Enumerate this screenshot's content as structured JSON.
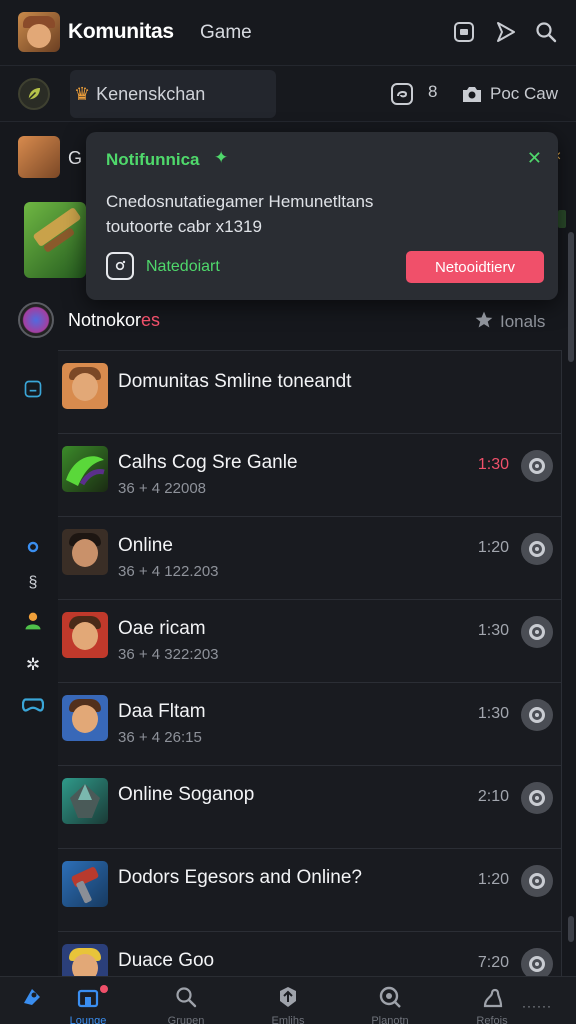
{
  "header": {
    "title": "Komunitas",
    "subtitle": "Game",
    "icons": [
      "window-icon",
      "send-icon",
      "search-icon"
    ]
  },
  "subbar": {
    "pill_label": "Kenenskchan",
    "right_label": "Poc Caw",
    "count": "8"
  },
  "row0": {
    "label": "G"
  },
  "notification": {
    "title": "Notifunnica",
    "body_line1": "Cnedosnutatiegamer Hemunetltans",
    "body_line2": "toutoorte cabr x1319",
    "link": "Natedoiart",
    "button": "Netooidtierv"
  },
  "section": {
    "title_main": "Notnokor",
    "title_accent": "es",
    "right_label": "Ionals"
  },
  "items": [
    {
      "name": "Domunitas Smline toneandt",
      "meta": "",
      "time": "",
      "highlight": false,
      "thumb": "#d88b4e",
      "hair": "#7b4826"
    },
    {
      "name": "Calhs Cog Sre Ganle",
      "meta": "36 + 4 22008",
      "time": "1:30",
      "highlight": true,
      "thumb": "#3b8a2a",
      "hair": "#5a2f8a"
    },
    {
      "name": "Online",
      "meta": "36 + 4 122.203",
      "time": "1:20",
      "highlight": false,
      "thumb": "#3a2e26",
      "hair": "#1d1612"
    },
    {
      "name": "Oae ricam",
      "meta": "36 + 4 322:203",
      "time": "1:30",
      "highlight": false,
      "thumb": "#c0392b",
      "hair": "#4a2a18"
    },
    {
      "name": "Daa Fltam",
      "meta": "36 + 4 26:15",
      "time": "1:30",
      "highlight": false,
      "thumb": "#3868b8",
      "hair": "#52301c"
    },
    {
      "name": "Online Soganop",
      "meta": "",
      "time": "2:10",
      "highlight": false,
      "thumb": "#2f9a8a",
      "hair": "#28584f"
    },
    {
      "name": "Dodors Egesors and Online?",
      "meta": "",
      "time": "1:20",
      "highlight": false,
      "thumb": "#2d6fb8",
      "hair": "#b83a2d"
    },
    {
      "name": "Duace Goo",
      "meta": "",
      "time": "7:20",
      "highlight": false,
      "thumb": "#2b3f7a",
      "hair": "#e8c43a"
    }
  ],
  "bottomnav": [
    {
      "label": "Lounge",
      "icon": "home-icon",
      "active": true
    },
    {
      "label": "Grupen",
      "icon": "store-icon",
      "active": false
    },
    {
      "label": "Cauvet",
      "icon": "search-icon",
      "active": false
    },
    {
      "label": "Emlihs",
      "icon": "upload-icon",
      "active": false
    },
    {
      "label": "Planotn",
      "icon": "explore-icon",
      "active": false
    },
    {
      "label": "Refois",
      "icon": "profile-icon",
      "active": false
    }
  ]
}
